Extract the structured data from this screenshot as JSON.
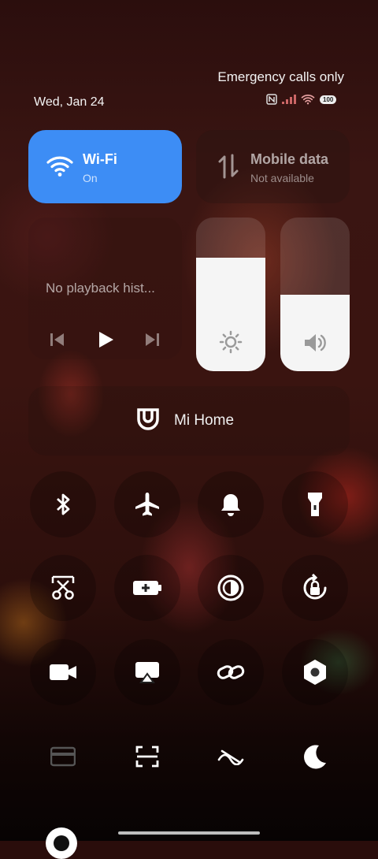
{
  "status": {
    "emergency": "Emergency calls only",
    "date": "Wed, Jan 24",
    "battery": "100"
  },
  "tiles": {
    "wifi": {
      "title": "Wi-Fi",
      "subtitle": "On",
      "color": "#3d8df5"
    },
    "mobile": {
      "title": "Mobile data",
      "subtitle": "Not available"
    }
  },
  "media": {
    "text": "No playback hist..."
  },
  "sliders": {
    "brightness_level": 0.74,
    "volume_level": 0.5
  },
  "mihome": {
    "label": "Mi Home"
  },
  "toggles": [
    {
      "icon": "bluetooth-icon"
    },
    {
      "icon": "airplane-icon"
    },
    {
      "icon": "bell-icon"
    },
    {
      "icon": "flashlight-icon"
    },
    {
      "icon": "scissors-icon"
    },
    {
      "icon": "battery-saver-icon"
    },
    {
      "icon": "reading-mode-icon"
    },
    {
      "icon": "rotation-lock-icon"
    },
    {
      "icon": "video-camera-icon"
    },
    {
      "icon": "cast-icon"
    },
    {
      "icon": "link-icon"
    },
    {
      "icon": "hexagon-settings-icon"
    },
    {
      "icon": "card-icon"
    },
    {
      "icon": "scan-icon"
    },
    {
      "icon": "no-disturb-icon"
    },
    {
      "icon": "moon-icon"
    }
  ]
}
